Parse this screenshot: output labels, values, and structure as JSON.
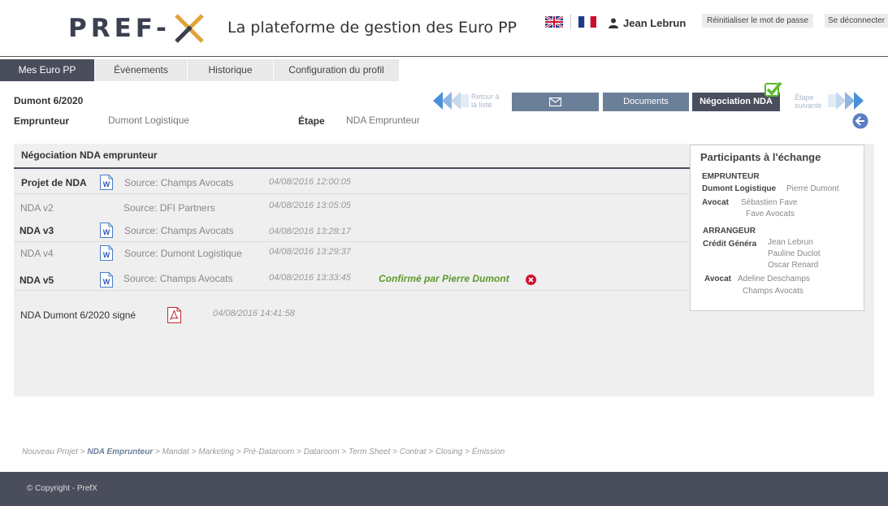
{
  "header": {
    "logo_text": "PREF-",
    "site_title": "La plateforme de gestion des Euro PP",
    "user_name": "Jean Lebrun",
    "reset_password_label": "Réinitialiser le mot de passe",
    "logout_label": "Se déconnecter"
  },
  "tabs": [
    {
      "label": "Mes Euro PP",
      "active": true
    },
    {
      "label": "Évènements",
      "active": false
    },
    {
      "label": "Historique",
      "active": false
    },
    {
      "label": "Configuration du profil",
      "active": false
    }
  ],
  "project": {
    "name": "Dumont 6/2020",
    "borrower_label": "Emprunteur",
    "borrower_value": "Dumont Logistique",
    "step_label": "Étape",
    "step_value": "NDA Emprunteur"
  },
  "step_nav": {
    "back_line1": "Retour à",
    "back_line2": "la liste",
    "next_line1": "Étape",
    "next_line2": "suivante",
    "documents_label": "Documents",
    "nda_label": "Négociation NDA"
  },
  "panel": {
    "title": "Négociation NDA emprunteur",
    "rows": [
      {
        "name": "Projet de NDA",
        "source": "Source: Champs Avocats",
        "date": "04/08/2016  12:00:05",
        "bold": true
      },
      {
        "name": "NDA v2",
        "source": "Source:  DFI Partners",
        "date": "04/08/2016  13:05:05",
        "bold": false
      },
      {
        "name": "NDA v3",
        "source": "Source: Champs Avocats",
        "date": "04/08/2016  13:28:17",
        "bold": true
      },
      {
        "name": "NDA v4",
        "source": "Source:  Dumont Logistique",
        "date": "04/08/2016  13:29:37",
        "bold": false
      },
      {
        "name": "NDA v5",
        "source": "Source: Champs Avocats",
        "date": "04/08/2016  13:33:45",
        "bold": true,
        "status": "Confirmé par Pierre Dumont"
      }
    ],
    "signed": {
      "name": "NDA Dumont 6/2020 signé",
      "date": "04/08/2016  14:41:58"
    }
  },
  "participants": {
    "title": "Participants à l'échange",
    "emprunteur_heading": "EMPRUNTEUR",
    "emprunteur_company": "Dumont Logistique",
    "emprunteur_contact": "Pierre Dumont",
    "avocat_label": "Avocat",
    "emprunteur_avocat_name": "Sébastien Fave",
    "emprunteur_avocat_firm": "Fave Avocats",
    "arrangeur_heading": "ARRANGEUR",
    "arrangeur_company": "Crédit Généra",
    "arrangeur_contacts": [
      "Jean Lebrun",
      "Pauline Duclot",
      "Oscar Renard"
    ],
    "arrangeur_avocat_name": "Adeline Deschamps",
    "arrangeur_avocat_firm": "Champs Avocats"
  },
  "breadcrumb": {
    "first": "Nouveau Projet",
    "current": "NDA Emprunteur",
    "rest": "Mandat > Marketing > Pré-Dataroom > Dataroom > Term Sheet > Contrat > Closing > Émission",
    "separator": " > "
  },
  "footer": {
    "copyright": "©  Copyright - PrefX"
  },
  "colors": {
    "dark_nav": "#4a4d5c",
    "step_blue": "#6b7f99",
    "confirm_green": "#5c9a2c",
    "arrow_blue": "#4a90d9"
  }
}
